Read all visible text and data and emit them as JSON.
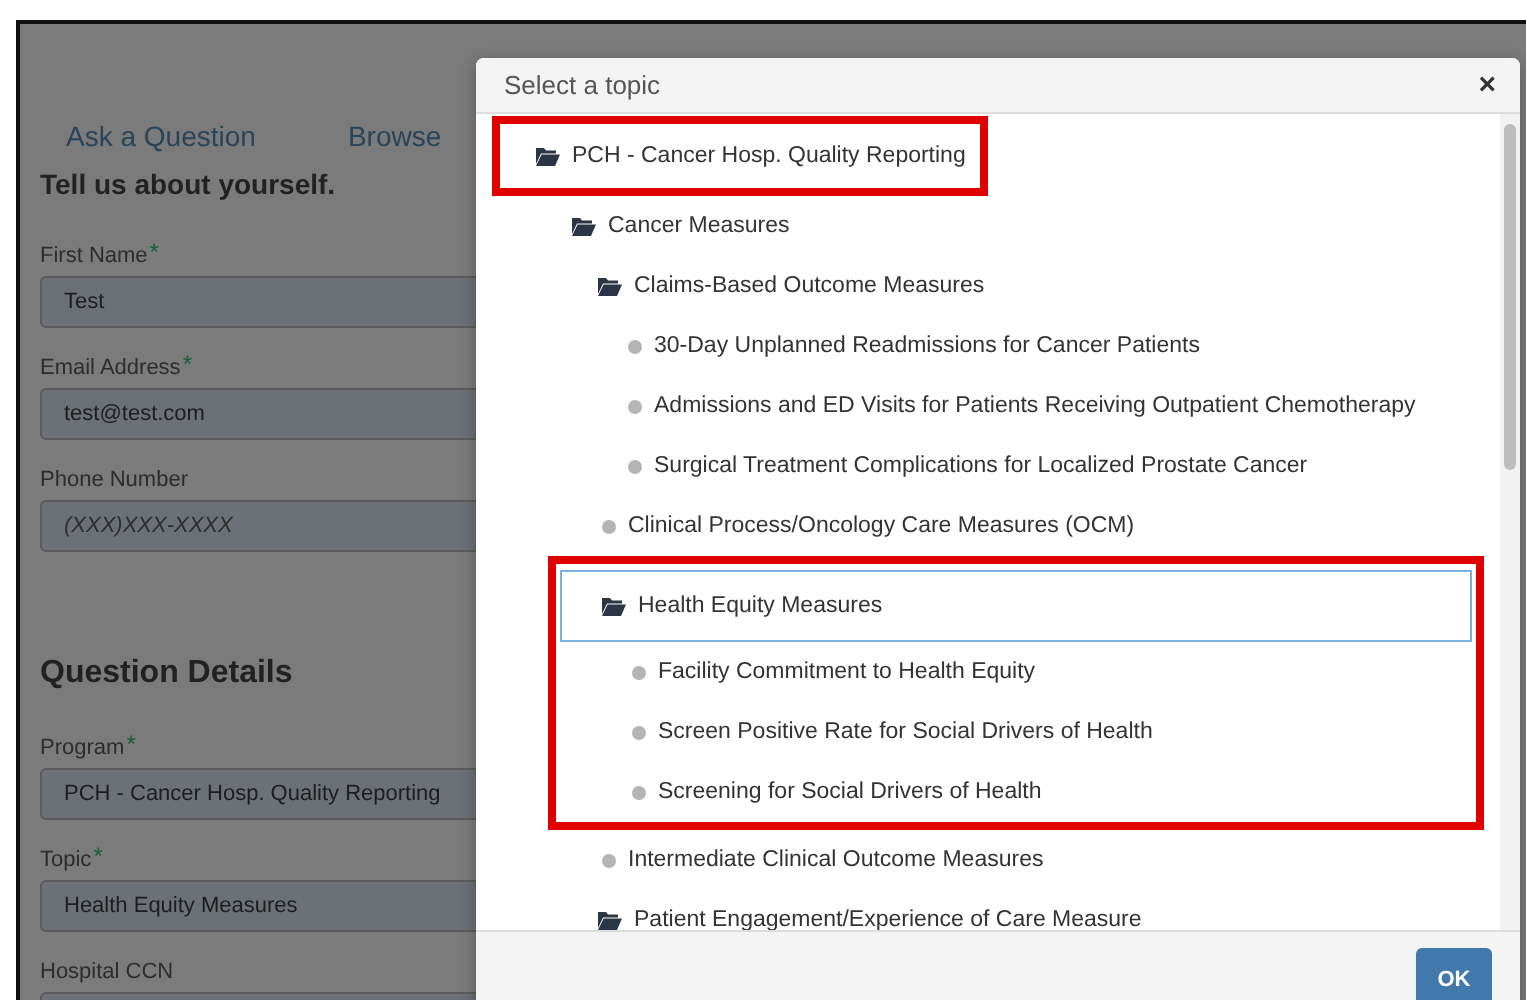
{
  "page": {
    "tabs": [
      {
        "label": "Ask a Question"
      },
      {
        "label": "Browse"
      }
    ],
    "sections": [
      {
        "heading": "Tell us about yourself.",
        "fields": [
          {
            "label": "First Name",
            "required_mark": "*",
            "value": "Test"
          },
          {
            "label": "Email Address",
            "required_mark": "*",
            "value": "test@test.com"
          },
          {
            "label": "Phone Number",
            "placeholder": "(XXX)XXX-XXXX"
          }
        ]
      },
      {
        "heading": "Question Details",
        "fields": [
          {
            "label": "Program",
            "required_mark": "*",
            "value": "PCH - Cancer Hosp. Quality Reporting"
          },
          {
            "label": "Topic",
            "required_mark": "*",
            "value": "Health Equity Measures"
          },
          {
            "label": "Hospital CCN"
          }
        ]
      }
    ]
  },
  "dialog": {
    "title": "Select a topic",
    "close": "×",
    "ok_button": "OK",
    "tree": [
      {
        "kind": "folder",
        "label": "PCH - Cancer Hosp. Quality Reporting",
        "selected": false,
        "highlighted": true,
        "children": [
          {
            "kind": "folder",
            "label": "Cancer Measures",
            "selected": false,
            "highlighted": false,
            "children": [
              {
                "kind": "folder",
                "label": "Claims-Based Outcome Measures",
                "selected": false,
                "highlighted": false,
                "children": [
                  {
                    "kind": "leaf",
                    "label": "30-Day Unplanned Readmissions for Cancer Patients",
                    "selected": false,
                    "highlighted": false
                  },
                  {
                    "kind": "leaf",
                    "label": "Admissions and ED Visits for Patients Receiving Outpatient Chemotherapy",
                    "selected": false,
                    "highlighted": false
                  },
                  {
                    "kind": "leaf",
                    "label": "Surgical Treatment Complications for Localized Prostate Cancer",
                    "selected": false,
                    "highlighted": false
                  }
                ]
              },
              {
                "kind": "leaf",
                "label": "Clinical Process/Oncology Care Measures (OCM)",
                "selected": false,
                "highlighted": false
              },
              {
                "kind": "folder",
                "label": "Health Equity Measures",
                "selected": true,
                "highlighted": true,
                "children": [
                  {
                    "kind": "leaf",
                    "label": "Facility Commitment to Health Equity",
                    "selected": false,
                    "highlighted": true
                  },
                  {
                    "kind": "leaf",
                    "label": "Screen Positive Rate for Social Drivers of Health",
                    "selected": false,
                    "highlighted": true
                  },
                  {
                    "kind": "leaf",
                    "label": "Screening for Social Drivers of Health",
                    "selected": false,
                    "highlighted": true
                  }
                ]
              },
              {
                "kind": "leaf",
                "label": "Intermediate Clinical Outcome Measures",
                "selected": false,
                "highlighted": false
              },
              {
                "kind": "folder",
                "label": "Patient Engagement/Experience of Care Measure",
                "selected": false,
                "highlighted": false
              }
            ]
          }
        ]
      }
    ]
  }
}
